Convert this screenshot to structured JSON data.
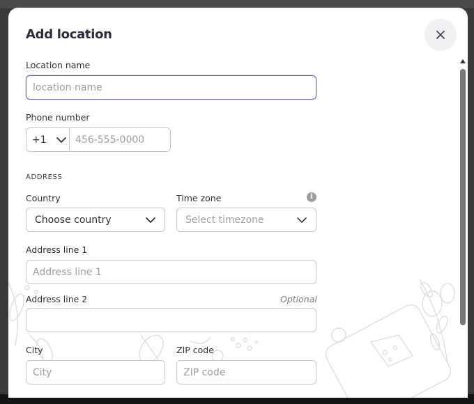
{
  "dialog": {
    "title": "Add location",
    "close_glyph": "✕"
  },
  "location_name": {
    "label": "Location name",
    "placeholder": "location name",
    "value": ""
  },
  "phone": {
    "label": "Phone number",
    "country_code": "+1",
    "placeholder": "456-555-0000",
    "value": ""
  },
  "address": {
    "section_title": "ADDRESS",
    "country": {
      "label": "Country",
      "value": "Choose country"
    },
    "timezone": {
      "label": "Time zone",
      "value": "Select timezone",
      "info_glyph": "i"
    },
    "line1": {
      "label": "Address line 1",
      "placeholder": "Address line 1"
    },
    "line2": {
      "label": "Address line 2",
      "optional": "Optional",
      "placeholder": ""
    },
    "city": {
      "label": "City",
      "placeholder": "City"
    },
    "zip": {
      "label": "ZIP code",
      "placeholder": "ZIP code"
    }
  },
  "icons": [
    "close-icon",
    "chevron-down-icon",
    "info-icon",
    "scroll-up-arrow-icon"
  ],
  "colors": {
    "focus_border": "#6c6aa6",
    "placeholder": "#9d9da6",
    "text": "#2f2f3a",
    "scroll_thumb": "#777777"
  }
}
